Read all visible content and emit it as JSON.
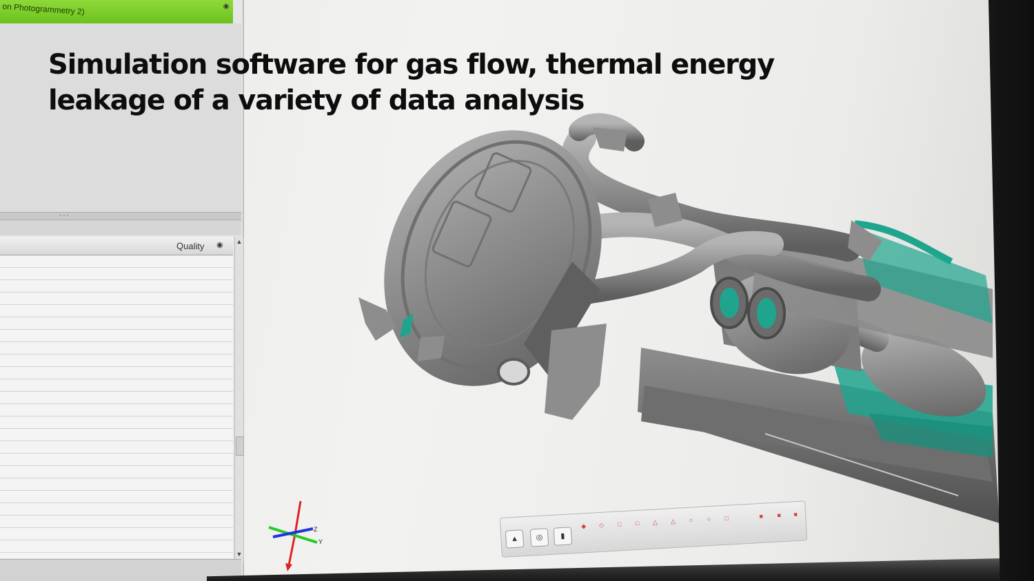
{
  "caption": {
    "line1": "Simulation software for gas flow, thermal energy",
    "line2": "leakage of a variety of data analysis"
  },
  "tree": {
    "selected_item": "on Photogrammetry 2)"
  },
  "list": {
    "column_quality": "Quality"
  },
  "axes": {
    "z": "Z",
    "y": "Y"
  },
  "colors": {
    "tree_highlight": "#7ccf2a",
    "model_gray": "#8a8a8a",
    "model_teal": "#1fa58e"
  },
  "icons": [
    "eye-icon",
    "scroll-up-icon",
    "scroll-down-icon",
    "axis-triad-icon",
    "toolbar-icon"
  ]
}
